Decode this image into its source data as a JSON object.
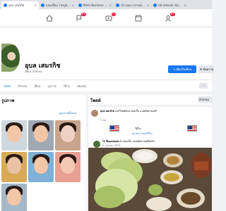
{
  "browser": {
    "tabs": [
      {
        "label": "อุบล เสมรกิช",
        "active": true,
        "favicon_color": "#1877f2"
      },
      {
        "label": "แชมเปี้ยน โปรดูนิยม ยุคชน",
        "active": false,
        "favicon_color": "#1877f2"
      },
      {
        "label": "Meta Business Suite",
        "active": false,
        "favicon_color": "#1877f2"
      },
      {
        "label": "(2) ตอน เวลาหน้าเพจ | Facebook",
        "active": false,
        "favicon_color": "#1877f2"
      },
      {
        "label": "หน้าหลักหน้า Ibid สมาชิกปีนักเรียนนะ",
        "active": false,
        "favicon_color": "#1877f2"
      }
    ],
    "close_glyph": "×"
  },
  "nav": {
    "icons": [
      "home-icon",
      "flag-icon",
      "video-icon",
      "marketplace-icon",
      "groups-icon"
    ],
    "flag_badge": "9+",
    "marketplace_badge": "1",
    "groups_badge": "9+"
  },
  "profile": {
    "name": "อุบล เสมรกิช",
    "friends": "เพื่อน 318 คน",
    "add_friend_label": "เพิ่มเป็นเพื่อน",
    "message_label": "ข้อความ"
  },
  "profile_tabs": [
    "โพสต์",
    "เกี่ยวกับ",
    "เพื่อน",
    "รูปภาพ",
    "วิดีโอ",
    "เพิ่มเติม"
  ],
  "more_label": "···",
  "left": {
    "title": "รูปภาพ",
    "see_all": "ดูรูปภาพทั้งหมด"
  },
  "posts": {
    "title": "โพสต์",
    "filter_label": "ตัวกรอง"
  },
  "post": {
    "author": "อุบล เสมรกิช",
    "header_text": "แชร์โพสต์ของ ทองเกิ้น แนทท์คล์ สมศรี",
    "time": "1 ชม.",
    "share_title": "วิดีโอ",
    "share_sub": "ดูรายการของวิดีโอ",
    "inner_author": "ไก่ ซีคอนพลอท",
    "inner_text": "กับ ทองเกิ้น แนทท์คล์ สมศรีพรกิจ",
    "inner_time": "2 เมษายน 2022"
  },
  "colors": {
    "accent": "#1877f2",
    "badge": "#e41e3f"
  }
}
